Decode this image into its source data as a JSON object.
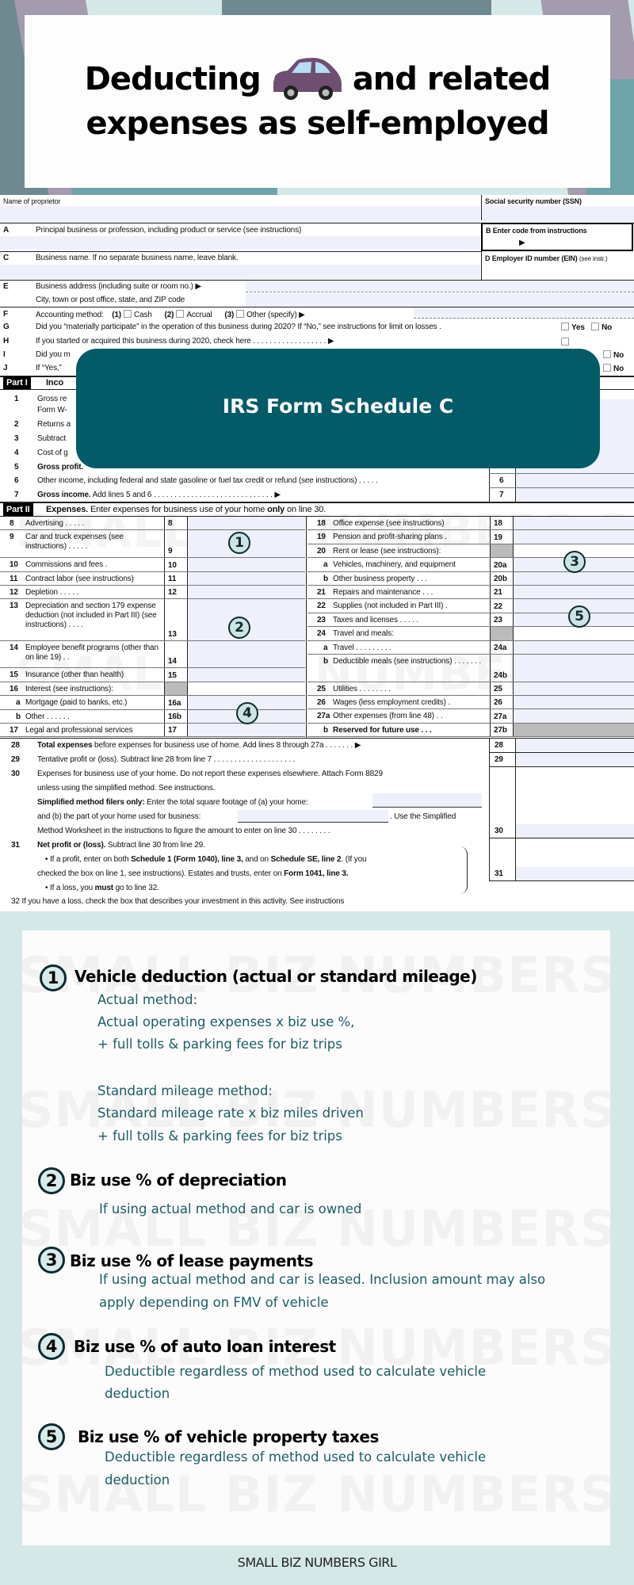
{
  "header": {
    "title_line1_a": "Deducting",
    "title_line1_b": "and related",
    "title_line2": "expenses as self-employed",
    "title_icon": "car-icon"
  },
  "colors": {
    "accent_teal": "#045b68",
    "background": "#d5e8e8",
    "body_text": "#1c5d66",
    "car": "#6e4f72"
  },
  "overlay_label": "IRS Form Schedule C",
  "form": {
    "name_label": "Name of proprietor",
    "ssn_label": "Social security number (SSN)",
    "a_letter": "A",
    "a_label": "Principal business or profession, including product or service (see instructions)",
    "b_label": "B  Enter code from instructions",
    "c_letter": "C",
    "c_label": "Business name. If no separate business name, leave blank.",
    "d_label": "D  Employer ID number (EIN)",
    "d_note": "(see instr.)",
    "e_letter": "E",
    "e_label": "Business address (including suite or room no.) ▶",
    "e_city": "City, town or post office, state, and ZIP code",
    "f_letter": "F",
    "f_label": "Accounting method:",
    "f_opt1_num": "(1)",
    "f_opt1": "Cash",
    "f_opt2_num": "(2)",
    "f_opt2": "Accrual",
    "f_opt3_num": "(3)",
    "f_opt3": "Other (specify) ▶",
    "g_letter": "G",
    "g_label": "Did you “materially participate” in the operation of this business during 2020? If “No,” see instructions for limit on losses   .",
    "yes": "Yes",
    "no": "No",
    "h_letter": "H",
    "h_label": "If you started or acquired this business during 2020, check here  .  .  .  .  .  .  .  .  .  .  .  .  .  .  .  .  .  .  ▶",
    "i_letter": "I",
    "i_label": "Did you m",
    "j_letter": "J",
    "j_label": "If “Yes,”",
    "part1_tag": "Part I",
    "part1_title": "Inco",
    "part1_lines": [
      {
        "num": "1",
        "label": "Gross re",
        "label2": "Form W-"
      },
      {
        "num": "2",
        "label": "Returns a"
      },
      {
        "num": "3",
        "label": "Subtract"
      },
      {
        "num": "4",
        "label": "Cost of g"
      },
      {
        "num": "5",
        "label": "Gross profit."
      },
      {
        "num": "6",
        "label": "Other income, including federal and state gasoline or fuel tax credit or refund (see instructions)  .  .  .  .  .",
        "box": "6"
      },
      {
        "num": "7",
        "label": "Gross income.",
        "label_rest": " Add lines 5 and 6  .  .  .  .  .  .  .  .  .  .  .  .  .  .  .  .  .  .  .  .  .  .  .  .  .  .  .  .  .  ▶",
        "box": "7"
      }
    ],
    "part2_tag": "Part II",
    "part2_title": "Expenses.",
    "part2_desc_a": " Enter expenses for business use of your home ",
    "part2_desc_b": "only",
    "part2_desc_c": " on line 30.",
    "expenses_left": [
      {
        "num": "8",
        "label": "Advertising  .  .  .  .  .",
        "box": "8"
      },
      {
        "num": "9",
        "label": "Car and truck expenses (see instructions)  .  .  .  .  .",
        "box": "9"
      },
      {
        "num": "10",
        "label": "Commissions and fees   .",
        "box": "10"
      },
      {
        "num": "11",
        "label": "Contract labor (see instructions)",
        "box": "11"
      },
      {
        "num": "12",
        "label": "Depletion  .  .  .  .  .",
        "box": "12"
      },
      {
        "num": "13",
        "label": "Depreciation and section 179 expense deduction (not included in Part III) (see instructions)  .  .  .  .",
        "box": "13"
      },
      {
        "num": "14",
        "label": "Employee benefit programs (other than on line 19)  .  .",
        "box": "14"
      },
      {
        "num": "15",
        "label": "Insurance (other than health)",
        "box": "15"
      },
      {
        "num": "16",
        "label": "Interest (see instructions):",
        "box": ""
      },
      {
        "num": "a",
        "label": "Mortgage (paid to banks, etc.)",
        "box": "16a"
      },
      {
        "num": "b",
        "label": "Other  .  .  .  .  .  .",
        "box": "16b"
      },
      {
        "num": "17",
        "label": "Legal and professional services",
        "box": "17"
      }
    ],
    "expenses_right": [
      {
        "num": "18",
        "label": "Office expense (see instructions)",
        "box": "18"
      },
      {
        "num": "19",
        "label": "Pension and profit-sharing plans   .",
        "box": "19"
      },
      {
        "num": "20",
        "label": "Rent or lease (see instructions):",
        "box": ""
      },
      {
        "num": "a",
        "label": "Vehicles, machinery, and equipment",
        "box": "20a"
      },
      {
        "num": "b",
        "label": "Other business property  .  .  .",
        "box": "20b"
      },
      {
        "num": "21",
        "label": "Repairs and maintenance  .  .  .",
        "box": "21"
      },
      {
        "num": "22",
        "label": "Supplies (not included in Part III)  .",
        "box": "22"
      },
      {
        "num": "23",
        "label": "Taxes and licenses  .  .  .  .  .",
        "box": "23"
      },
      {
        "num": "24",
        "label": "Travel and meals:",
        "box": ""
      },
      {
        "num": "a",
        "label": "Travel  .  .  .  .  .  .  .  .  .",
        "box": "24a"
      },
      {
        "num": "b",
        "label": "Deductible meals (see instructions)  .  .  .  .  .  .  .",
        "box": "24b"
      },
      {
        "num": "25",
        "label": "Utilities  .  .  .  .  .  .  .  .",
        "box": "25"
      },
      {
        "num": "26",
        "label": "Wages (less employment credits) .",
        "box": "26"
      },
      {
        "num": "27a",
        "label": "Other expenses (from line 48)  .   .",
        "box": "27a"
      },
      {
        "num": "b",
        "label": "Reserved for future use  .  .  .",
        "box": "27b"
      }
    ],
    "l28_num": "28",
    "l28_bold": "Total expenses",
    "l28_rest": " before expenses for business use of home. Add lines 8 through 27a  .  .  .  .  .  .  .  ▶",
    "l28_box": "28",
    "l29_num": "29",
    "l29_label": "Tentative profit or (loss). Subtract line 28 from line 7  .  .  .  .  .  .  .  .  .  .  .  .  .  .  .  .  .  .  .  .",
    "l29_box": "29",
    "l30_num": "30",
    "l30_line1": "Expenses for business use of your home. Do not report these expenses elsewhere. Attach Form 8829",
    "l30_line2": "unless using the simplified method. See instructions.",
    "l30_simpl_bold": "Simplified method filers only:",
    "l30_simpl_rest": " Enter the total square footage of (a) your home:",
    "l30_b_label": "and (b) the part of your home used for business:",
    "l30_b_rest": ". Use the Simplified",
    "l30_line5": "Method Worksheet in the instructions to figure the amount to enter on line 30  .  .  .  .  .  .  .  .",
    "l30_box": "30",
    "l31_num": "31",
    "l31_bold": "Net profit or (loss).",
    "l31_rest": "  Subtract line 30 from line 29.",
    "l31_b1_a": "•  If a profit, enter on both ",
    "l31_b1_b": "Schedule 1 (Form 1040), line 3,",
    "l31_b1_c": " and on ",
    "l31_b1_d": "Schedule SE, line 2",
    "l31_b1_e": ". (If you",
    "l31_b2_a": "checked the box on line 1, see instructions). Estates and trusts, enter on ",
    "l31_b2_b": "Form 1041, line 3.",
    "l31_b3_a": "•  If a loss, you ",
    "l31_b3_b": "must",
    "l31_b3_c": "  go to line 32.",
    "l31_box": "31",
    "l32_partial": "32     If you have a loss, check the box that describes your investment in this activity. See instructions"
  },
  "watermark": "SMALL BIZ NUMBERS GIRL",
  "markers": [
    "1",
    "2",
    "3",
    "4",
    "5"
  ],
  "explanations": [
    {
      "num": "1",
      "title": "Vehicle deduction (actual or standard mileage)",
      "lines": [
        "Actual method:",
        "Actual operating expenses x biz use %,",
        "+ full tolls & parking fees for biz trips",
        "Standard mileage method:",
        "Standard mileage rate x biz miles driven",
        "+ full tolls & parking fees for biz trips"
      ]
    },
    {
      "num": "2",
      "title": "Biz use % of depreciation",
      "lines": [
        "If using actual method and car is owned"
      ]
    },
    {
      "num": "3",
      "title": "Biz use % of lease payments",
      "lines": [
        "If using actual method and car is leased. Inclusion amount may also",
        "apply depending on FMV of vehicle"
      ]
    },
    {
      "num": "4",
      "title": "Biz use % of auto loan interest",
      "lines": [
        "Deductible regardless of method used to calculate vehicle",
        "deduction"
      ]
    },
    {
      "num": "5",
      "title": "Biz use % of vehicle property taxes",
      "lines": [
        "Deductible regardless of method used to calculate vehicle",
        "deduction"
      ]
    }
  ],
  "footer": "SMALL BIZ NUMBERS GIRL"
}
